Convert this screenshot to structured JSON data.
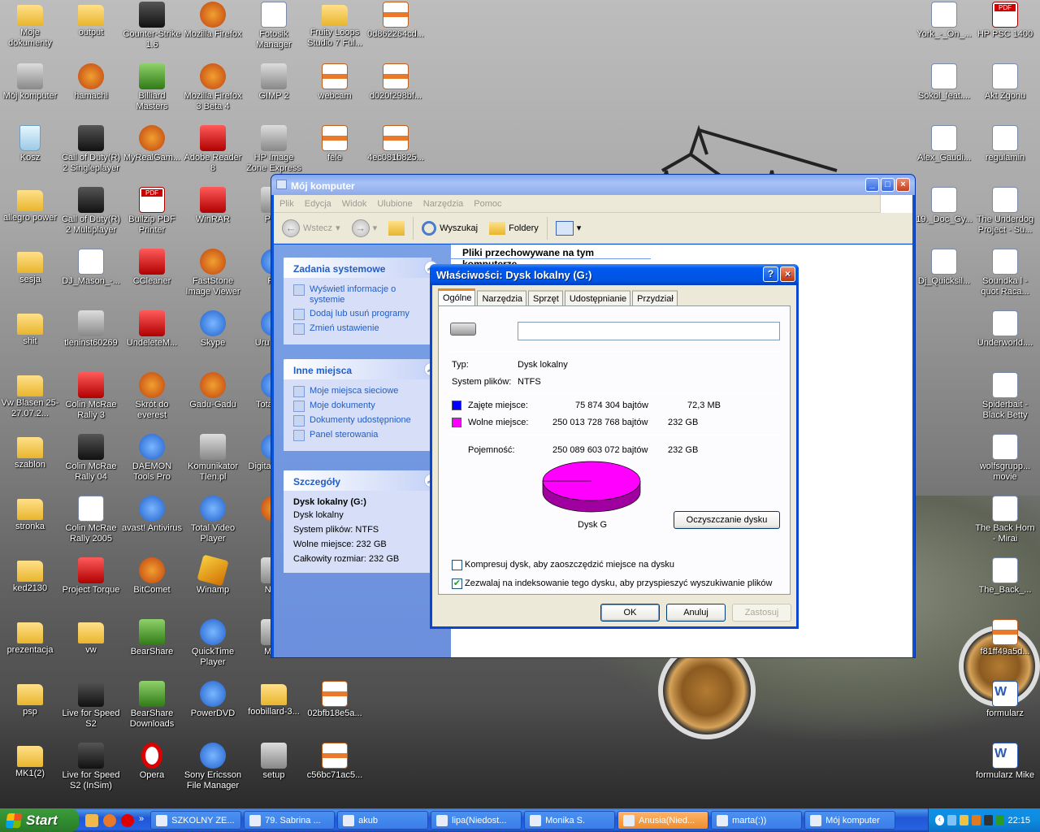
{
  "desktop_icons": [
    {
      "label": "Moje dokumenty",
      "icon": "documents-icon",
      "kind": "folder"
    },
    {
      "label": "output",
      "icon": "folder-icon",
      "kind": "folder"
    },
    {
      "label": "Counter-Strike 1.6",
      "icon": "counter-strike-icon",
      "kind": "dark"
    },
    {
      "label": "Mozilla Firefox",
      "icon": "firefox-icon",
      "kind": "app"
    },
    {
      "label": "Fotosik Manager",
      "icon": "fotosik-icon",
      "kind": "doc"
    },
    {
      "label": "Fruity Loops Studio 7 Ful...",
      "icon": "folder-icon",
      "kind": "folder"
    },
    {
      "label": "0d862264cd...",
      "icon": "archive-icon",
      "kind": "zip"
    },
    {
      "label": "Mój komputer",
      "icon": "my-computer-icon",
      "kind": "gray"
    },
    {
      "label": "hamachi",
      "icon": "hamachi-icon",
      "kind": "app"
    },
    {
      "label": "Billiard Masters",
      "icon": "billiard-icon",
      "kind": "green"
    },
    {
      "label": "Mozilla Firefox 3 Beta 4",
      "icon": "firefox-icon",
      "kind": "app"
    },
    {
      "label": "GIMP 2",
      "icon": "gimp-icon",
      "kind": "gray"
    },
    {
      "label": "webcam",
      "icon": "archive-icon",
      "kind": "zip"
    },
    {
      "label": "d020f298bf...",
      "icon": "archive-icon",
      "kind": "zip"
    },
    {
      "label": "Kosz",
      "icon": "recycle-bin-icon",
      "kind": "recycle"
    },
    {
      "label": "Call of Duty(R) 2 Singleplayer",
      "icon": "call-of-duty-icon",
      "kind": "dark"
    },
    {
      "label": "MyRealGam...",
      "icon": "myrealgames-icon",
      "kind": "app"
    },
    {
      "label": "Adobe Reader 8",
      "icon": "adobe-reader-icon",
      "kind": "red"
    },
    {
      "label": "HP Image Zone Express",
      "icon": "hp-image-zone-icon",
      "kind": "gray"
    },
    {
      "label": "fele",
      "icon": "archive-icon",
      "kind": "zip"
    },
    {
      "label": "4ec081b825...",
      "icon": "archive-icon",
      "kind": "zip"
    },
    {
      "label": "allegro power",
      "icon": "folder-icon",
      "kind": "folder"
    },
    {
      "label": "Call of Duty(R) 2 Multiplayer",
      "icon": "call-of-duty-icon",
      "kind": "dark"
    },
    {
      "label": "Bullzip PDF Printer",
      "icon": "pdf-printer-icon",
      "kind": "pdf"
    },
    {
      "label": "WinRAR",
      "icon": "winrar-icon",
      "kind": "red"
    },
    {
      "label": "Phot",
      "icon": "photo-icon",
      "kind": "gray"
    },
    {
      "label": "sesja",
      "icon": "folder-icon",
      "kind": "folder"
    },
    {
      "label": "DJ_Mason_-...",
      "icon": "audio-file-icon",
      "kind": "doc"
    },
    {
      "label": "CCleaner",
      "icon": "ccleaner-icon",
      "kind": "red"
    },
    {
      "label": "FastStone Image Viewer",
      "icon": "faststone-icon",
      "kind": "app"
    },
    {
      "label": "Pic",
      "icon": "picture-icon",
      "kind": "blue"
    },
    {
      "label": "shit",
      "icon": "folder-icon",
      "kind": "folder"
    },
    {
      "label": "tleninst60269",
      "icon": "installer-icon",
      "kind": "gray"
    },
    {
      "label": "UndeleteM...",
      "icon": "undelete-icon",
      "kind": "red"
    },
    {
      "label": "Skype",
      "icon": "skype-icon",
      "kind": "blue"
    },
    {
      "label": "Uru progr",
      "icon": "program-icon",
      "kind": "blue"
    },
    {
      "label": "Vw Blasen 25-27.07.2...",
      "icon": "folder-icon",
      "kind": "folder"
    },
    {
      "label": "Colin McRae Rally 3",
      "icon": "colin-mcrae-icon",
      "kind": "red"
    },
    {
      "label": "Skrót do everest",
      "icon": "everest-icon",
      "kind": "app"
    },
    {
      "label": "Gadu-Gadu",
      "icon": "gadu-gadu-icon",
      "kind": "app"
    },
    {
      "label": "Tota Con",
      "icon": "program-icon",
      "kind": "blue"
    },
    {
      "label": "szablon",
      "icon": "folder-icon",
      "kind": "folder"
    },
    {
      "label": "Colin McRae Rally 04",
      "icon": "colin-mcrae-icon",
      "kind": "dark"
    },
    {
      "label": "DAEMON Tools Pro",
      "icon": "daemon-tools-icon",
      "kind": "blue"
    },
    {
      "label": "Komunikator Tlen.pl",
      "icon": "tlen-icon",
      "kind": "gray"
    },
    {
      "label": "Digita Conve",
      "icon": "program-icon",
      "kind": "blue"
    },
    {
      "label": "stronka",
      "icon": "folder-icon",
      "kind": "folder"
    },
    {
      "label": "Colin McRae Rally 2005",
      "icon": "colin-mcrae-icon",
      "kind": "doc"
    },
    {
      "label": "avast! Antivirus",
      "icon": "avast-icon",
      "kind": "blue"
    },
    {
      "label": "Total Video Player",
      "icon": "video-player-icon",
      "kind": "blue"
    },
    {
      "label": "P",
      "icon": "program-icon",
      "kind": "app"
    },
    {
      "label": "ked2130",
      "icon": "folder-icon",
      "kind": "folder"
    },
    {
      "label": "Project Torque",
      "icon": "project-torque-icon",
      "kind": "red"
    },
    {
      "label": "BitComet",
      "icon": "bitcomet-icon",
      "kind": "app"
    },
    {
      "label": "Winamp",
      "icon": "winamp-icon",
      "kind": "winamp"
    },
    {
      "label": "Napi",
      "icon": "program-icon",
      "kind": "gray"
    },
    {
      "label": "prezentacja",
      "icon": "folder-icon",
      "kind": "folder"
    },
    {
      "label": "vw",
      "icon": "folder-icon",
      "kind": "folder"
    },
    {
      "label": "BearShare",
      "icon": "bearshare-icon",
      "kind": "green"
    },
    {
      "label": "QuickTime Player",
      "icon": "quicktime-icon",
      "kind": "blue"
    },
    {
      "label": "Medi",
      "icon": "media-icon",
      "kind": "gray"
    },
    {
      "label": "psp",
      "icon": "folder-icon",
      "kind": "folder"
    },
    {
      "label": "Live for Speed S2",
      "icon": "live-for-speed-icon",
      "kind": "dark"
    },
    {
      "label": "BearShare Downloads",
      "icon": "bearshare-icon",
      "kind": "green"
    },
    {
      "label": "PowerDVD",
      "icon": "powerdvd-icon",
      "kind": "blue"
    },
    {
      "label": "foobillard-3...",
      "icon": "folder-icon",
      "kind": "folder"
    },
    {
      "label": "02bfb18e5a...",
      "icon": "archive-icon",
      "kind": "zip"
    },
    {
      "label": "MK1(2)",
      "icon": "folder-icon",
      "kind": "folder"
    },
    {
      "label": "Live for Speed S2 (InSim)",
      "icon": "live-for-speed-icon",
      "kind": "dark"
    },
    {
      "label": "Opera",
      "icon": "opera-icon",
      "kind": "opera"
    },
    {
      "label": "Sony Ericsson File Manager",
      "icon": "file-manager-icon",
      "kind": "blue"
    },
    {
      "label": "setup",
      "icon": "cd-icon",
      "kind": "gray"
    },
    {
      "label": "c56bc71ac5...",
      "icon": "archive-icon",
      "kind": "zip"
    },
    {
      "label": "York_-_On_...",
      "icon": "audio-file-icon",
      "kind": "doc"
    },
    {
      "label": "HP PSC 1400",
      "icon": "pdf-icon",
      "kind": "pdf"
    },
    {
      "label": "Sokol_feat....",
      "icon": "audio-file-icon",
      "kind": "doc"
    },
    {
      "label": "Akt Zgonu",
      "icon": "text-file-icon",
      "kind": "doc"
    },
    {
      "label": "Alex_Gaudi...",
      "icon": "audio-file-icon",
      "kind": "doc"
    },
    {
      "label": "regulamin",
      "icon": "opera-file-icon",
      "kind": "doc"
    },
    {
      "label": "19._Doc_Gy...",
      "icon": "audio-file-icon",
      "kind": "doc"
    },
    {
      "label": "The Underdog Project - Su...",
      "icon": "audio-file-icon",
      "kind": "doc"
    },
    {
      "label": "Dj_Quicksil...",
      "icon": "audio-file-icon",
      "kind": "doc"
    },
    {
      "label": "Soundka l - quot Raca...",
      "icon": "audio-file-icon",
      "kind": "doc"
    },
    {
      "label": "Underworld....",
      "icon": "audio-file-icon",
      "kind": "doc"
    },
    {
      "label": "Spiderbait - Black Betty",
      "icon": "audio-file-icon",
      "kind": "doc"
    },
    {
      "label": "wolfsgrupp... movie",
      "icon": "audio-file-icon",
      "kind": "doc"
    },
    {
      "label": "The Back Horn - Mirai",
      "icon": "audio-file-icon",
      "kind": "doc"
    },
    {
      "label": "The_Back_...",
      "icon": "audio-file-icon",
      "kind": "doc"
    },
    {
      "label": "f81ff49a5d...",
      "icon": "archive-icon",
      "kind": "zip"
    },
    {
      "label": "formularz",
      "icon": "word-doc-icon",
      "kind": "word"
    },
    {
      "label": "formularz Mike",
      "icon": "word-doc-icon",
      "kind": "word"
    }
  ],
  "explorer": {
    "title": "Mój komputer",
    "menu": [
      "Plik",
      "Edycja",
      "Widok",
      "Ulubione",
      "Narzędzia",
      "Pomoc"
    ],
    "toolbar": {
      "back": "Wstecz",
      "search": "Wyszukaj",
      "folders": "Foldery"
    },
    "right_header": "Pliki przechowywane na tym komputerze",
    "panels": {
      "system_tasks": {
        "title": "Zadania systemowe",
        "links": [
          "Wyświetl informacje o systemie",
          "Dodaj lub usuń programy",
          "Zmień ustawienie"
        ]
      },
      "other_places": {
        "title": "Inne miejsca",
        "links": [
          "Moje miejsca sieciowe",
          "Moje dokumenty",
          "Dokumenty udostępnione",
          "Panel sterowania"
        ]
      },
      "details": {
        "title": "Szczegóły",
        "name": "Dysk lokalny (G:)",
        "type": "Dysk lokalny",
        "fs": "System plików: NTFS",
        "free": "Wolne miejsce: 232 GB",
        "total": "Całkowity rozmiar: 232 GB"
      }
    }
  },
  "dialog": {
    "title": "Właściwości: Dysk lokalny (G:)",
    "tabs": [
      "Ogólne",
      "Narzędzia",
      "Sprzęt",
      "Udostępnianie",
      "Przydział"
    ],
    "active_tab": "Ogólne",
    "name_value": "",
    "type_label": "Typ:",
    "type_value": "Dysk lokalny",
    "fs_label": "System plików:",
    "fs_value": "NTFS",
    "used_label": "Zajęte miejsce:",
    "used_bytes": "75 874 304 bajtów",
    "used_size": "72,3 MB",
    "free_label": "Wolne miejsce:",
    "free_bytes": "250 013 728 768 bajtów",
    "free_size": "232 GB",
    "capacity_label": "Pojemność:",
    "capacity_bytes": "250 089 603 072 bajtów",
    "capacity_size": "232 GB",
    "used_fraction": 0.0003,
    "used_color": "#0000ff",
    "free_color": "#ff00ff",
    "drive_label": "Dysk G",
    "cleanup_button": "Oczyszczanie dysku",
    "compress_label": "Kompresuj dysk, aby zaoszczędzić miejsce na dysku",
    "compress_checked": false,
    "index_label": "Zezwalaj na indeksowanie tego dysku, aby przyspieszyć wyszukiwanie plików",
    "index_checked": true,
    "ok": "OK",
    "cancel": "Anuluj",
    "apply": "Zastosuj"
  },
  "taskbar": {
    "start": "Start",
    "buttons": [
      {
        "label": "SZKOLNY ZE...",
        "flash": false
      },
      {
        "label": "79. Sabrina ...",
        "flash": false
      },
      {
        "label": "akub",
        "flash": false
      },
      {
        "label": "lipa(Niedost...",
        "flash": false
      },
      {
        "label": "Monika S.",
        "flash": false
      },
      {
        "label": "Anusia(Nied...",
        "flash": true
      },
      {
        "label": "marta(:))",
        "flash": false
      },
      {
        "label": "Mój komputer",
        "flash": false
      }
    ],
    "quicklaunch_more": "»",
    "clock": "22:15"
  }
}
